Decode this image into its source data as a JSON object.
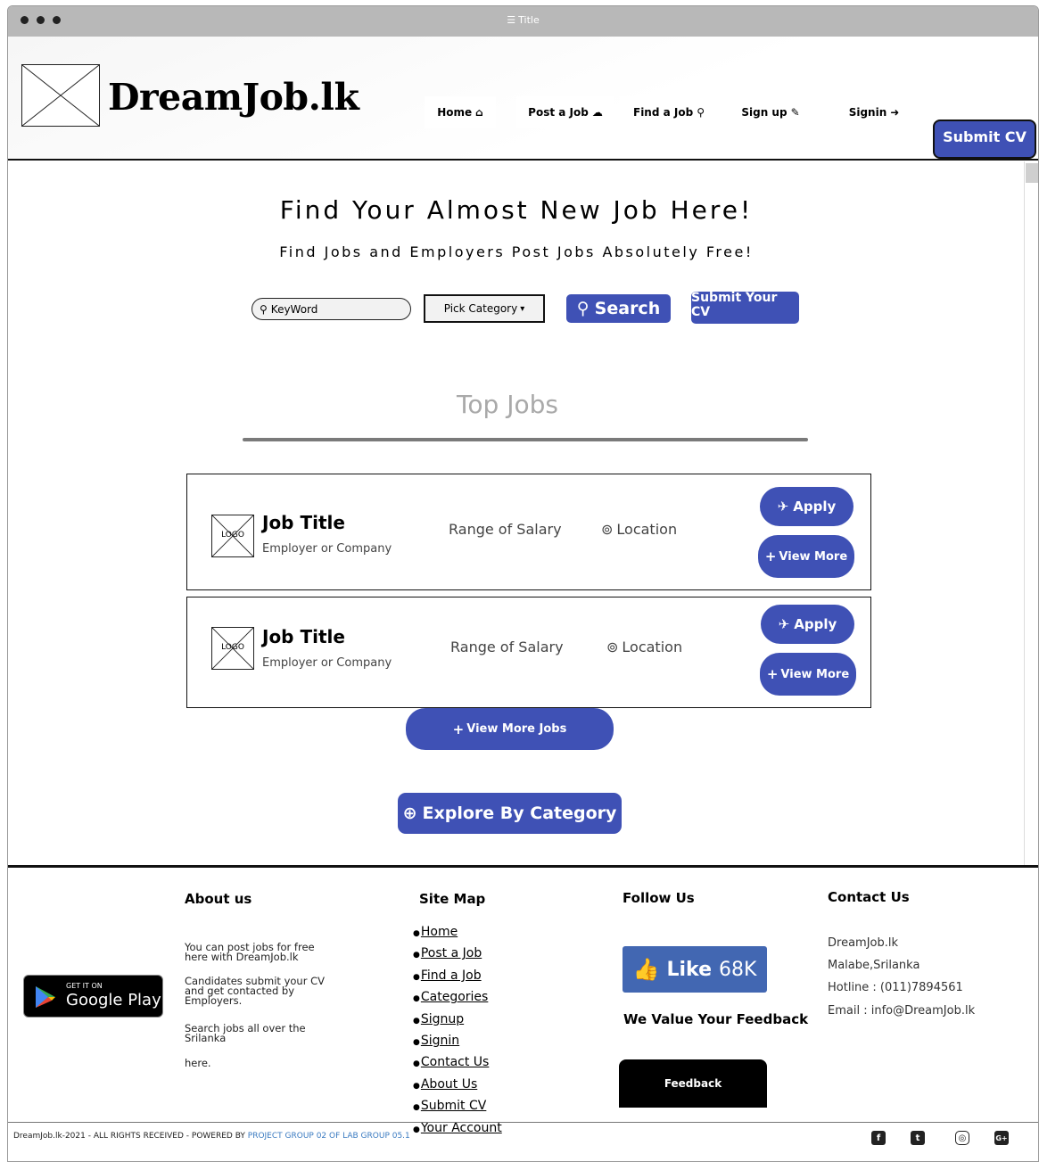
{
  "window": {
    "title": "Title"
  },
  "header": {
    "brand": "DreamJob.lk",
    "nav": [
      {
        "label": "Home",
        "icon": "home-icon",
        "glyph": "🏠"
      },
      {
        "label": "Post a Job",
        "icon": "cloud-upload-icon",
        "glyph": "☁"
      },
      {
        "label": "Find a Job",
        "icon": "search-icon",
        "glyph": "🔍"
      },
      {
        "label": "Sign up",
        "icon": "edit-icon",
        "glyph": "✎"
      },
      {
        "label": "Signin",
        "icon": "sign-in-icon",
        "glyph": "➜"
      }
    ],
    "submit_cv": "Submit CV"
  },
  "hero": {
    "title": "Find Your Almost New Job Here!",
    "subtitle": "Find Jobs and Employers Post Jobs Absolutely Free!",
    "search_placeholder": "KeyWord",
    "category": "Pick Category",
    "search_label": "Search",
    "submit_cv": "Submit Your CV"
  },
  "top_jobs": {
    "heading": "Top Jobs",
    "jobs": [
      {
        "logo": "LOGO",
        "title": "Job Title",
        "company": "Employer or Company",
        "salary": "Range of Salary",
        "location": "Location",
        "apply": "Apply",
        "view_more": "View More"
      },
      {
        "logo": "LOGO",
        "title": "Job Title",
        "company": "Employer or Company",
        "salary": "Range of Salary",
        "location": "Location",
        "apply": "Apply",
        "view_more": "View More"
      }
    ],
    "view_more_jobs": "View More Jobs",
    "explore": "Explore By Category"
  },
  "footer": {
    "google_play": {
      "get": "GET IT ON",
      "store": "Google Play"
    },
    "about": {
      "heading": "About us",
      "p1": "You can post jobs for free here with DreamJob.lk",
      "p2": "Candidates submit your CV and get contacted by Employers.",
      "p3": "Search jobs all over the Srilanka",
      "p4": "here."
    },
    "sitemap": {
      "heading": "Site Map",
      "links": [
        "Home",
        "Post a Job",
        "Find a Job",
        "Categories",
        "Signup",
        "Signin",
        "Contact Us",
        "About Us",
        "Submit CV",
        "Your Account"
      ]
    },
    "follow": {
      "heading": "Follow Us",
      "like_label": "Like",
      "like_count": "68K",
      "value_feedback": "We Value Your Feedback",
      "feedback_button": "Feedback"
    },
    "contact": {
      "heading": "Contact Us",
      "name": "DreamJob.lk",
      "address": "Malabe,Srilanka",
      "hotline": "Hotline : (011)7894561",
      "email": "Email  : info@DreamJob.lk"
    },
    "copyright_text": "DreamJob.lk-2021 - ALL RIGHTS RECEIVED - POWERED BY ",
    "copyright_link": "PROJECT GROUP 02 OF LAB GROUP 05.1",
    "social": [
      "facebook-icon",
      "twitter-icon",
      "instagram-icon",
      "google-plus-icon"
    ]
  }
}
